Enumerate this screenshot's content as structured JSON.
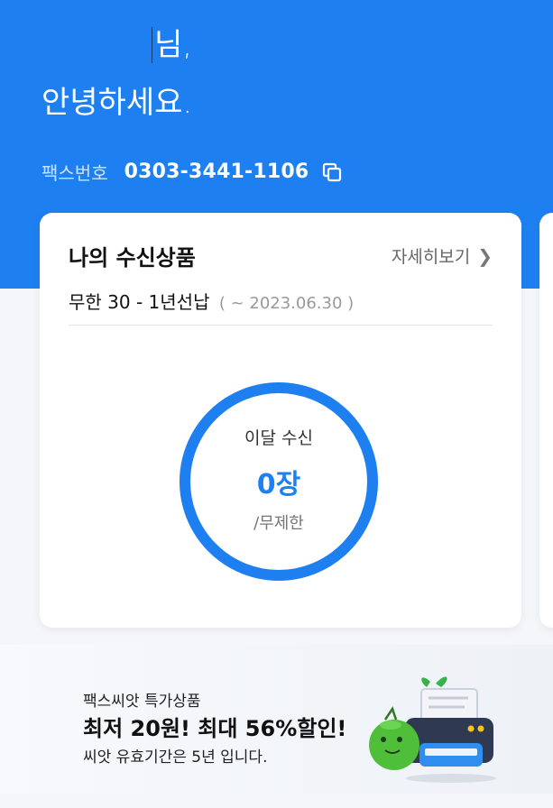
{
  "greeting": {
    "line1": "님,",
    "line2": "안녕하세요."
  },
  "fax": {
    "label": "팩스번호",
    "number": "0303-3441-1106",
    "copy_icon": "copy-icon"
  },
  "card": {
    "title": "나의 수신상품",
    "more_label": "자세히보기",
    "more_icon": "chevron-right-icon",
    "plan_name": "무한 30 - 1년선납",
    "plan_period": "( ~ 2023.06.30 )",
    "gauge": {
      "label": "이달 수신",
      "value": "0장",
      "sub": "/무제한",
      "fill_fraction": 1.0,
      "color": "#1e80f0"
    }
  },
  "promo": {
    "small": "팩스씨앗 특가상품",
    "big": "최저 20원! 최대 56%할인!",
    "note": "씨앗 유효기간은 5년 입니다.",
    "illustration": "fax-machine-with-seed-character"
  },
  "colors": {
    "primary": "#1e80f0",
    "background": "#f4f6fa"
  }
}
